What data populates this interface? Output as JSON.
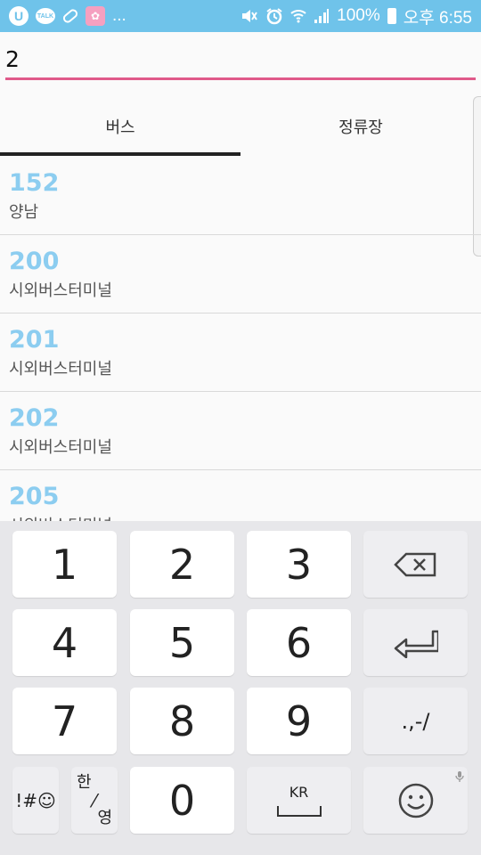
{
  "status_bar": {
    "notification_icons": [
      "uplus-icon",
      "kakaotalk-icon",
      "pill-icon",
      "game-app-icon"
    ],
    "uplus_glyph": "U",
    "talk_label": "TALK",
    "more": "...",
    "battery": "100%",
    "time": "오후 6:55",
    "system_icons": [
      "mute-vibrate-icon",
      "alarm-icon",
      "wifi-icon",
      "signal-icon",
      "battery-icon"
    ]
  },
  "search": {
    "value": "2",
    "accent_color": "#e05a8a"
  },
  "tabs": [
    {
      "label": "버스",
      "active": true
    },
    {
      "label": "정류장",
      "active": false
    }
  ],
  "routes": [
    {
      "number": "152",
      "destination": "양남"
    },
    {
      "number": "200",
      "destination": "시외버스터미널"
    },
    {
      "number": "201",
      "destination": "시외버스터미널"
    },
    {
      "number": "202",
      "destination": "시외버스터미널"
    },
    {
      "number": "205",
      "destination": "시외버스터미널"
    }
  ],
  "route_number_color": "#8ccdf0",
  "keyboard": {
    "digits": [
      "1",
      "2",
      "3",
      "4",
      "5",
      "6",
      "7",
      "8",
      "9",
      "0"
    ],
    "symbols_key": "!#☺",
    "hangul_key_top": "한",
    "hangul_key_bottom": "영",
    "language_key": "KR",
    "punctuation_key": ".,-/",
    "backspace_icon": "backspace-icon",
    "enter_icon": "enter-icon",
    "emoji_icon": "emoji-icon",
    "mic_icon": "mic-icon"
  }
}
